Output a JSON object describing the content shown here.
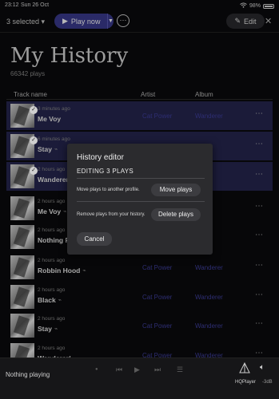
{
  "status": {
    "time": "23:12",
    "date": "Sun 26 Oct",
    "battery": "98%"
  },
  "topbar": {
    "selected_label": "3 selected",
    "play_now": "Play now",
    "edit": "Edit"
  },
  "page": {
    "title": "My History",
    "plays": "66342 plays"
  },
  "columns": {
    "track": "Track name",
    "artist": "Artist",
    "album": "Album"
  },
  "rows": [
    {
      "ago": "3 minutes ago",
      "name": "Me Voy",
      "artist": "Cat Power",
      "album": "Wanderer",
      "selected": true,
      "hq": false
    },
    {
      "ago": "6 minutes ago",
      "name": "Stay",
      "artist": "",
      "album": "",
      "selected": true,
      "hq": true
    },
    {
      "ago": "2 hours ago",
      "name": "Wanderer/",
      "artist": "",
      "album": "",
      "selected": true,
      "hq": false
    },
    {
      "ago": "2 hours ago",
      "name": "Me Voy",
      "artist": "",
      "album": "",
      "selected": false,
      "hq": true
    },
    {
      "ago": "2 hours ago",
      "name": "Nothing Re",
      "artist": "",
      "album": "",
      "selected": false,
      "hq": false
    },
    {
      "ago": "2 hours ago",
      "name": "Robbin Hood",
      "artist": "Cat Power",
      "album": "Wanderer",
      "selected": false,
      "hq": true
    },
    {
      "ago": "2 hours ago",
      "name": "Black",
      "artist": "Cat Power",
      "album": "Wanderer",
      "selected": false,
      "hq": true
    },
    {
      "ago": "2 hours ago",
      "name": "Stay",
      "artist": "Cat Power",
      "album": "Wanderer",
      "selected": false,
      "hq": true
    },
    {
      "ago": "2 hours ago",
      "name": "Wanderer/",
      "artist": "Cat Power",
      "album": "Wanderer",
      "selected": false,
      "hq": false
    }
  ],
  "modal": {
    "title": "History editor",
    "subtitle": "EDITING 3 PLAYS",
    "move_desc": "Move plays to another profile.",
    "move_btn": "Move plays",
    "delete_desc": "Remove plays from your history.",
    "delete_btn": "Delete plays",
    "cancel": "Cancel"
  },
  "player": {
    "now_playing": "Nothing playing",
    "device": "HQPlayer",
    "volume": "-3dB"
  }
}
